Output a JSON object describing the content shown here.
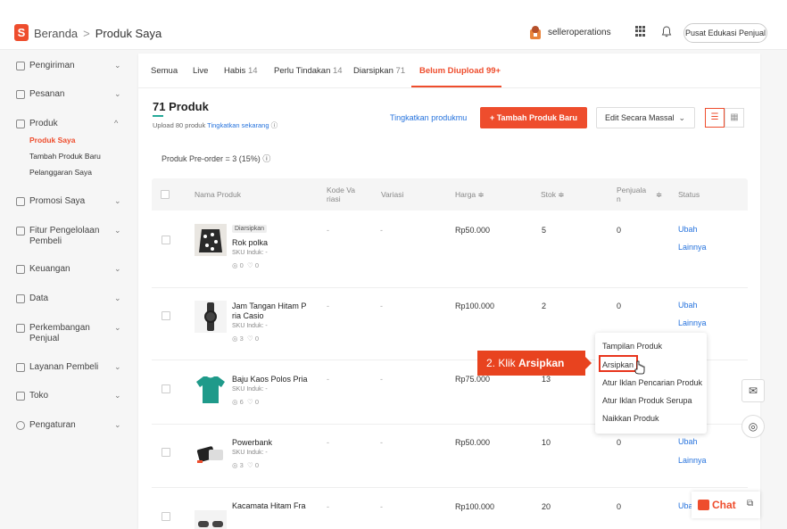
{
  "header": {
    "logo_letter": "S",
    "breadcrumb_home": "Beranda",
    "breadcrumb_sep": ">",
    "breadcrumb_current": "Produk Saya",
    "username": "selleroperations",
    "edu_button": "Pusat Edukasi Penjual",
    "icons": [
      "avatar-icon",
      "apps-grid-icon",
      "bell-icon"
    ]
  },
  "sidebar": {
    "items": [
      {
        "label": "Pengiriman",
        "icon": "truck-icon"
      },
      {
        "label": "Pesanan",
        "icon": "order-icon"
      },
      {
        "label": "Produk",
        "icon": "product-icon"
      },
      {
        "label": "Promosi Saya",
        "icon": "tag-icon"
      },
      {
        "label": "Fitur Pengelolaan Pembeli",
        "icon": "users-icon"
      },
      {
        "label": "Keuangan",
        "icon": "wallet-icon"
      },
      {
        "label": "Data",
        "icon": "chart-icon"
      },
      {
        "label": "Perkembangan Penjual",
        "icon": "growth-icon"
      },
      {
        "label": "Layanan Pembeli",
        "icon": "chat-icon"
      },
      {
        "label": "Toko",
        "icon": "shop-icon"
      },
      {
        "label": "Pengaturan",
        "icon": "gear-icon"
      }
    ],
    "sub_items": [
      "Produk Saya",
      "Tambah Produk Baru",
      "Pelanggaran Saya"
    ],
    "chevron_down": "⌄",
    "chevron_up": "^"
  },
  "tabs": [
    {
      "label": "Semua",
      "count": ""
    },
    {
      "label": "Live",
      "count": ""
    },
    {
      "label": "Habis",
      "count": "14"
    },
    {
      "label": "Perlu Tindakan",
      "count": "14"
    },
    {
      "label": "Diarsipkan",
      "count": "71"
    },
    {
      "label": "Belum Diupload 99+",
      "count": ""
    }
  ],
  "summary": {
    "product_count": "71 Produk",
    "upload_note": "Upload 80 produk",
    "upgrade_now": "Tingkatkan sekarang",
    "upgrade_link": "Tingkatkan produkmu",
    "add_button": "+ Tambah Produk Baru",
    "bulk_edit": "Edit Secara Massal",
    "preorder": "Produk Pre-order = 3 (15%)"
  },
  "table": {
    "headers": [
      "Nama Produk",
      "Kode Va riasi",
      "Variasi",
      "Harga ≑",
      "Stok ≑",
      "Penjuala n",
      "Status"
    ],
    "rows": [
      {
        "badge": "Diarsipkan",
        "name": "Rok polka",
        "sku": "SKU Induk: -",
        "views": "0",
        "likes": "0",
        "kode": "-",
        "variasi": "-",
        "harga": "Rp50.000",
        "stok": "5",
        "penjualan": "0",
        "action1": "Ubah",
        "action2": "Lainnya"
      },
      {
        "badge": "",
        "name": "Jam Tangan Hitam P ria Casio",
        "sku": "SKU Induk: -",
        "views": "3",
        "likes": "0",
        "kode": "-",
        "variasi": "-",
        "harga": "Rp100.000",
        "stok": "2",
        "penjualan": "0",
        "action1": "Ubah",
        "action2": "Lainnya"
      },
      {
        "badge": "",
        "name": "Baju Kaos Polos Pria",
        "sku": "SKU Induk: -",
        "views": "6",
        "likes": "0",
        "kode": "-",
        "variasi": "-",
        "harga": "Rp75.000",
        "stok": "13",
        "penjualan": "",
        "action1": "",
        "action2": ""
      },
      {
        "badge": "",
        "name": "Powerbank",
        "sku": "SKU Induk: -",
        "views": "3",
        "likes": "0",
        "kode": "-",
        "variasi": "-",
        "harga": "Rp50.000",
        "stok": "10",
        "penjualan": "0",
        "action1": "Ubah",
        "action2": "Lainnya"
      },
      {
        "badge": "",
        "name": "Kacamata Hitam Fra",
        "sku": "",
        "views": "",
        "likes": "",
        "kode": "-",
        "variasi": "-",
        "harga": "Rp100.000",
        "stok": "20",
        "penjualan": "0",
        "action1": "Uba",
        "action2": ""
      }
    ]
  },
  "dropdown": {
    "items": [
      "Tampilan Produk",
      "Arsipkan",
      "Atur Iklan Pencarian Produk",
      "Atur Iklan Produk Serupa",
      "Naikkan Produk"
    ],
    "highlighted": "Arsipkan"
  },
  "callout": {
    "prefix": "2. Klik ",
    "bold": "Arsipkan"
  },
  "chat": {
    "label": "Chat"
  },
  "colors": {
    "brand": "#ee4d2d",
    "link": "#2673dd",
    "green": "#26aa99"
  }
}
